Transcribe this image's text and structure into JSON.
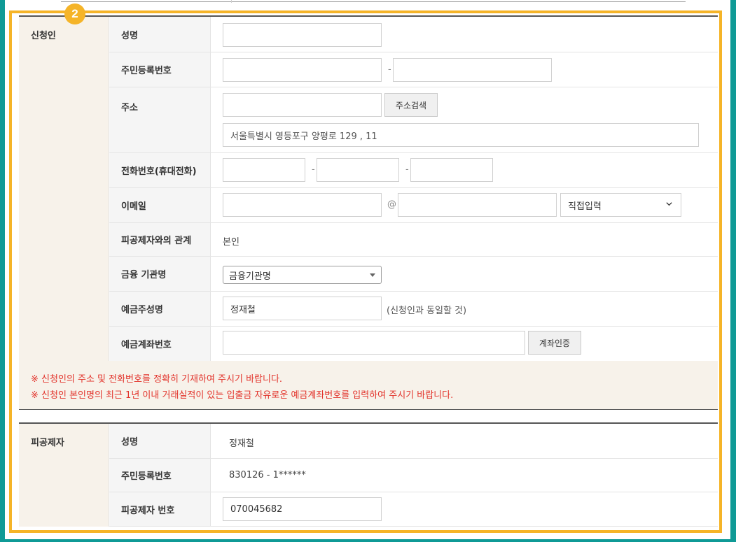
{
  "step_number": "2",
  "applicant": {
    "section_title": "신청인",
    "name_label": "성명",
    "rrn_label": "주민등록번호",
    "rrn_separator": "-",
    "address_label": "주소",
    "address_search_button": "주소검색",
    "address_detail_value": "서울특별시 영등포구 양평로 129 , 11",
    "phone_label": "전화번호(휴대전화)",
    "phone_separator": "-",
    "email_label": "이메일",
    "email_at": "@",
    "email_domain_select": "직접입력",
    "relation_label": "피공제자와의 관계",
    "relation_value": "본인",
    "bank_label": "금융 기관명",
    "bank_select": "금융기관명",
    "holder_label": "예금주성명",
    "holder_value": "정재철",
    "holder_note": "(신청인과 동일할 것)",
    "account_label": "예금계좌번호",
    "account_verify_button": "계좌인증"
  },
  "notices": [
    "※ 신청인의 주소 및 전화번호를 정확히 기재하여 주시기 바랍니다.",
    "※ 신청인 본인명의 최근 1년 이내 거래실적이 있는 입출금 자유로운 예금계좌번호를 입력하여 주시기 바랍니다."
  ],
  "insured": {
    "section_title": "피공제자",
    "name_label": "성명",
    "name_value": "정재철",
    "rrn_label": "주민등록번호",
    "rrn_value": "830126 - 1******",
    "number_label": "피공제자 번호",
    "number_value": "070045682"
  },
  "colors": {
    "frame": "#0f9a96",
    "highlight": "#f5b428",
    "notice_text": "#e2322a",
    "section_bg": "#f7f2ea"
  },
  "icons": {
    "select_arrow": "triangle-down",
    "dropdown": "chevron-down"
  }
}
